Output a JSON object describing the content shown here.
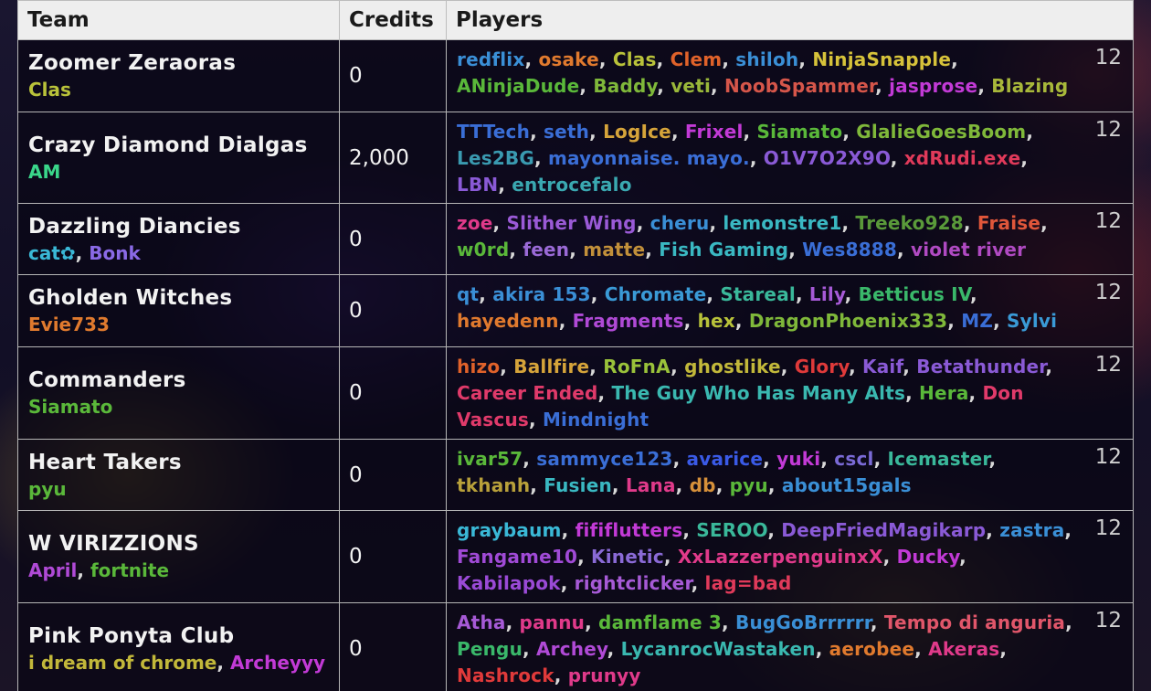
{
  "headers": {
    "team": "Team",
    "credits": "Credits",
    "players": "Players"
  },
  "rows": [
    {
      "team": "Zoomer Zeraoras",
      "captains": [
        {
          "name": "Clas",
          "color": "#b9c23a"
        }
      ],
      "credits": "0",
      "count": "12",
      "players": [
        {
          "name": "redflix",
          "color": "#3a8fd6"
        },
        {
          "name": "osake",
          "color": "#e07a2e"
        },
        {
          "name": "Clas",
          "color": "#b9c23a"
        },
        {
          "name": "Clem",
          "color": "#e0622a"
        },
        {
          "name": "shiloh",
          "color": "#3a8fd6"
        },
        {
          "name": "NinjaSnapple",
          "color": "#d6c23a"
        },
        {
          "name": "ANinjaDude",
          "color": "#5ab83a"
        },
        {
          "name": "Baddy",
          "color": "#7fb83a"
        },
        {
          "name": "veti",
          "color": "#9ab83a"
        },
        {
          "name": "NoobSpammer",
          "color": "#d6564a"
        },
        {
          "name": "jasprose",
          "color": "#c23ad6"
        },
        {
          "name": "Blazing",
          "color": "#a8b83a"
        }
      ]
    },
    {
      "team": "Crazy Diamond Dialgas",
      "captains": [
        {
          "name": "AM",
          "color": "#3ad68a"
        }
      ],
      "credits": "2,000",
      "count": "12",
      "players": [
        {
          "name": "TTTech",
          "color": "#3a6ed6"
        },
        {
          "name": "seth",
          "color": "#3a6ed6"
        },
        {
          "name": "LogIce",
          "color": "#d6a43a"
        },
        {
          "name": "Frixel",
          "color": "#c23ad6"
        },
        {
          "name": "Siamato",
          "color": "#5ab83a"
        },
        {
          "name": "GlalieGoesBoom",
          "color": "#7fb83a"
        },
        {
          "name": "Les2BG",
          "color": "#3a9ab0"
        },
        {
          "name": "mayonnaise. mayo.",
          "color": "#3a6ed6"
        },
        {
          "name": "O1V7O2X9O",
          "color": "#8a5ad6"
        },
        {
          "name": "xdRudi.exe",
          "color": "#e03a5a"
        },
        {
          "name": "LBN",
          "color": "#8a5ad6"
        },
        {
          "name": "entrocefalo",
          "color": "#3aa8b0"
        }
      ]
    },
    {
      "team": "Dazzling Diancies",
      "captains": [
        {
          "name": "cat✿",
          "color": "#3ab8d6"
        },
        {
          "name": "Bonk",
          "color": "#8a6ae6"
        }
      ],
      "credits": "0",
      "count": "12",
      "players": [
        {
          "name": "zoe",
          "color": "#e03a8a"
        },
        {
          "name": "Slither Wing",
          "color": "#9a5ad6"
        },
        {
          "name": "cheru",
          "color": "#3a8fd6"
        },
        {
          "name": "lemonstre1",
          "color": "#3ab8c2"
        },
        {
          "name": "Treeko928",
          "color": "#5a9a3a"
        },
        {
          "name": "Fraise",
          "color": "#e0563a"
        },
        {
          "name": "w0rd",
          "color": "#5ab83a"
        },
        {
          "name": "feen",
          "color": "#9a6ad6"
        },
        {
          "name": "matte",
          "color": "#c2903a"
        },
        {
          "name": "Fish Gaming",
          "color": "#3ab8c2"
        },
        {
          "name": "Wes8888",
          "color": "#3a6ed6"
        },
        {
          "name": "violet river",
          "color": "#b04ac2"
        }
      ]
    },
    {
      "team": "Gholden Witches",
      "captains": [
        {
          "name": "Evie733",
          "color": "#e07a2e"
        }
      ],
      "credits": "0",
      "count": "12",
      "players": [
        {
          "name": "qt",
          "color": "#3a8fd6"
        },
        {
          "name": "akira 153",
          "color": "#3a8fd6"
        },
        {
          "name": "Chromate",
          "color": "#3a9ad6"
        },
        {
          "name": "Stareal",
          "color": "#3ab89a"
        },
        {
          "name": "Lily",
          "color": "#a65ad6"
        },
        {
          "name": "Betticus IV",
          "color": "#3ab86a"
        },
        {
          "name": "hayedenn",
          "color": "#e07a2e"
        },
        {
          "name": "Fragments",
          "color": "#b04ad6"
        },
        {
          "name": "hex",
          "color": "#b8c23a"
        },
        {
          "name": "DragonPhoenix333",
          "color": "#7fb83a"
        },
        {
          "name": "MZ",
          "color": "#3a6ed6"
        },
        {
          "name": "Sylvi",
          "color": "#3a9ad6"
        }
      ]
    },
    {
      "team": "Commanders",
      "captains": [
        {
          "name": "Siamato",
          "color": "#5ab83a"
        }
      ],
      "credits": "0",
      "count": "12",
      "players": [
        {
          "name": "hizo",
          "color": "#e0622a"
        },
        {
          "name": "Ballfire",
          "color": "#d6a43a"
        },
        {
          "name": "RoFnA",
          "color": "#9ac23a"
        },
        {
          "name": "ghostlike",
          "color": "#c2b83a"
        },
        {
          "name": "Glory",
          "color": "#e03a3a"
        },
        {
          "name": "Kaif",
          "color": "#8a5ad6"
        },
        {
          "name": "Betathunder",
          "color": "#8a5ad6"
        },
        {
          "name": "Career Ended",
          "color": "#e03a6a"
        },
        {
          "name": "The Guy Who Has Many Alts",
          "color": "#3ab8b0"
        },
        {
          "name": "Hera",
          "color": "#5ab83a"
        },
        {
          "name": "Don Vascus",
          "color": "#e03a6a"
        },
        {
          "name": "Mindnight",
          "color": "#3a6ed6"
        }
      ]
    },
    {
      "team": "Heart Takers",
      "captains": [
        {
          "name": "pyu",
          "color": "#5ab83a"
        }
      ],
      "credits": "0",
      "count": "12",
      "players": [
        {
          "name": "ivar57",
          "color": "#5ab83a"
        },
        {
          "name": "sammyce123",
          "color": "#3a6ed6"
        },
        {
          "name": "avarice",
          "color": "#3a5ae6"
        },
        {
          "name": "yuki",
          "color": "#c23ad6"
        },
        {
          "name": "cscl",
          "color": "#7a6ad6"
        },
        {
          "name": "Icemaster",
          "color": "#3ab89a"
        },
        {
          "name": "tkhanh",
          "color": "#b8a03a"
        },
        {
          "name": "Fusien",
          "color": "#3ab8c2"
        },
        {
          "name": "Lana",
          "color": "#e03a8a"
        },
        {
          "name": "db",
          "color": "#d6903a"
        },
        {
          "name": "pyu",
          "color": "#5ab83a"
        },
        {
          "name": "about15gals",
          "color": "#3a8fd6"
        }
      ]
    },
    {
      "team": "W VIRIZZIONS",
      "captains": [
        {
          "name": "April",
          "color": "#b04ad6"
        },
        {
          "name": "fortnite",
          "color": "#5ab83a"
        }
      ],
      "credits": "0",
      "count": "12",
      "players": [
        {
          "name": "graybaum",
          "color": "#3ab8d6"
        },
        {
          "name": "fififlutters",
          "color": "#c23ad6"
        },
        {
          "name": "SEROO",
          "color": "#3ab89a"
        },
        {
          "name": "DeepFriedMagikarp",
          "color": "#8a5ad6"
        },
        {
          "name": "zastra",
          "color": "#3a8fd6"
        },
        {
          "name": "Fangame10",
          "color": "#a04ad6"
        },
        {
          "name": "Kinetic",
          "color": "#8a6ad6"
        },
        {
          "name": "XxLazzerpenguinxX",
          "color": "#e03a8a"
        },
        {
          "name": "Ducky",
          "color": "#c23ad6"
        },
        {
          "name": "Kabilapok",
          "color": "#9a4ad6"
        },
        {
          "name": "rightclicker",
          "color": "#a65ad6"
        },
        {
          "name": "lag=bad",
          "color": "#e03a5a"
        }
      ]
    },
    {
      "team": "Pink Ponyta Club",
      "captains": [
        {
          "name": "i dream of chrome",
          "color": "#c2b83a"
        },
        {
          "name": "Archeyyy",
          "color": "#c23ad6"
        }
      ],
      "credits": "0",
      "count": "12",
      "players": [
        {
          "name": "Atha",
          "color": "#a65ad6"
        },
        {
          "name": "pannu",
          "color": "#e03a8a"
        },
        {
          "name": "damflame 3",
          "color": "#5ab83a"
        },
        {
          "name": "BugGoBrrrrrr",
          "color": "#3a8fd6"
        },
        {
          "name": "Tempo di anguria",
          "color": "#e0566a"
        },
        {
          "name": "Pengu",
          "color": "#3ab86a"
        },
        {
          "name": "Archey",
          "color": "#b04ad6"
        },
        {
          "name": "LycanrocWastaken",
          "color": "#3ab8b0"
        },
        {
          "name": "aerobee",
          "color": "#e07a2e"
        },
        {
          "name": "Akeras",
          "color": "#e03a8a"
        },
        {
          "name": "Nashrock",
          "color": "#e03a3a"
        },
        {
          "name": "prunyy",
          "color": "#e03a8a"
        }
      ]
    }
  ]
}
